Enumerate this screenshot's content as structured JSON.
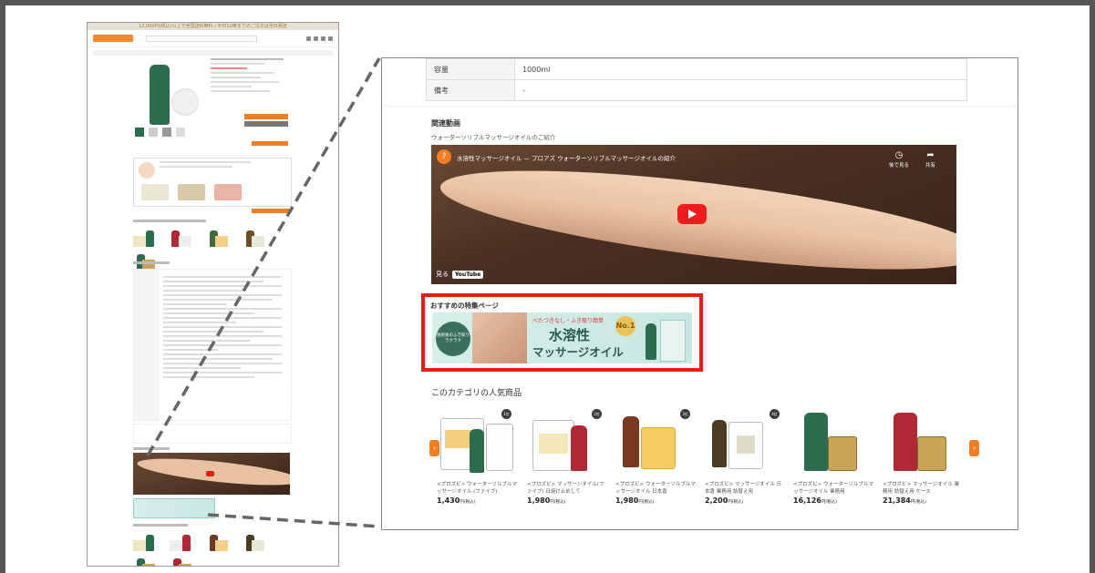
{
  "thumbnail": {
    "top_banner": "12,000円(税込)以上で全国送料無料 / 平日12時までのご注文は当日発送",
    "shop_logo": "Esthe Store"
  },
  "zoom": {
    "spec_rows": [
      {
        "label": "容量",
        "value": "1000ml"
      },
      {
        "label": "備考",
        "value": "-"
      }
    ],
    "video_section_title": "関連動画",
    "video_subtitle": "ウォーターソリブルマッサージオイルのご紹介",
    "video": {
      "logo": "?",
      "title": "水溶性マッサージオイル — プロアズ ウォーターソリブルマッサージオイルの紹介",
      "watch_later_label": "後で見る",
      "share_label": "共有",
      "watch_on": "見る",
      "youtube_label": "YouTube"
    },
    "feature": {
      "title": "おすすめの特集ページ",
      "banner_sub": "べたつきなし・ふき取り簡単",
      "banner_main": "水溶性",
      "banner_main2": "マッサージオイル",
      "banner_circle": "施術後のふき取りラクラク",
      "banner_no1": "No.1"
    },
    "popular_title": "このカテゴリの人気商品",
    "popular_products": [
      {
        "badge": "1位",
        "name": "<プロズビ> ウォーターソルブルマッサージオイル (ファイブ)",
        "price": "1,430",
        "price_unit": "円(税込)"
      },
      {
        "badge": "2位",
        "name": "<プロズビ> マッサージオイル(ファイブ) 日焼け止めして",
        "price": "1,980",
        "price_unit": "円(税込)"
      },
      {
        "badge": "3位",
        "name": "<プロズビ> ウォーターソルブルマッサージオイル 日本香",
        "price": "1,980",
        "price_unit": "円(税込)"
      },
      {
        "badge": "4位",
        "name": "<プロズビ> マッサージオイル 日本香 業務用 詰替え用",
        "price": "2,200",
        "price_unit": "円(税込)"
      },
      {
        "badge": "5位",
        "name": "<プロズビ> ウォーターソルブルマッサージオイル 業務用",
        "price": "16,126",
        "price_unit": "円(税込)"
      },
      {
        "badge": "6位",
        "name": "<プロズビ> マッサージオイル 業務用 詰替え用 ケース",
        "price": "21,384",
        "price_unit": "円(税込)"
      }
    ]
  },
  "colors": {
    "accent_red": "#e41e14",
    "orange": "#f07f24",
    "green": "#2d6b4f"
  }
}
